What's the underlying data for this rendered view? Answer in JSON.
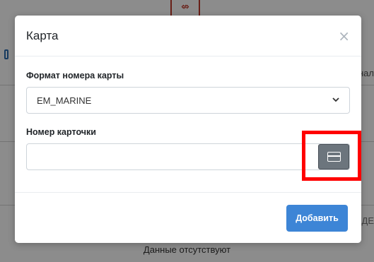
{
  "background": {
    "empty_text": "Данные отсутствуют",
    "right_text_1": "нал",
    "right_text_2": "ДЕ",
    "tag_icon": "ruble-like-icon"
  },
  "modal": {
    "title": "Карта",
    "close_label": "×",
    "format_field": {
      "label": "Формат номера карты",
      "value": "EM_MARINE"
    },
    "number_field": {
      "label": "Номер карточки",
      "value": ""
    },
    "card_button_icon": "card-icon",
    "add_button_label": "Добавить"
  },
  "colors": {
    "primary": "#3d85d6",
    "secondary": "#6c757d",
    "highlight": "#ff0000"
  }
}
